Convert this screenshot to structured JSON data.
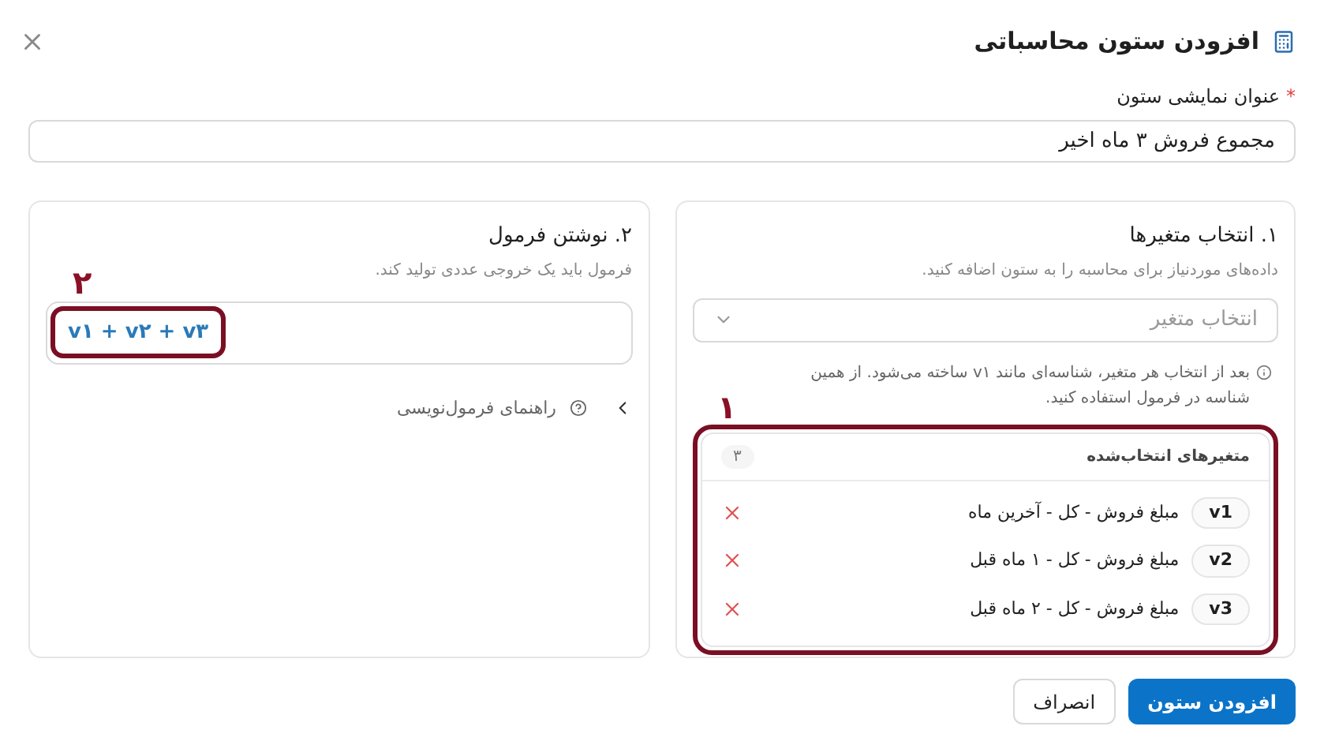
{
  "dialog": {
    "title": "افزودن ستون محاسباتی"
  },
  "column_title": {
    "label": "عنوان نمایشی ستون",
    "required_mark": "*",
    "value": "مجموع فروش ۳ ماه اخیر"
  },
  "variables_panel": {
    "heading": "۱. انتخاب متغیرها",
    "description": "داده‌های موردنیاز برای محاسبه را به ستون اضافه کنید.",
    "select": {
      "placeholder": "انتخاب متغیر"
    },
    "info": "بعد از انتخاب هر متغیر، شناسه‌ای مانند v۱ ساخته می‌شود. از همین شناسه در فرمول استفاده کنید.",
    "annotation": "۱",
    "selected": {
      "title": "متغیرهای انتخاب‌شده",
      "count": "۳",
      "items": [
        {
          "id": "v1",
          "label": "مبلغ فروش - کل - آخرین ماه"
        },
        {
          "id": "v2",
          "label": "مبلغ فروش - کل - ۱ ماه قبل"
        },
        {
          "id": "v3",
          "label": "مبلغ فروش - کل - ۲ ماه قبل"
        }
      ]
    }
  },
  "formula_panel": {
    "heading": "۲. نوشتن فرمول",
    "description": "فرمول باید یک خروجی عددی تولید کند.",
    "annotation": "۲",
    "value": "v۱ + v۲ + v۳",
    "help": {
      "label": "راهنمای فرمول‌نویسی",
      "expanded": false
    }
  },
  "buttons": [
    {
      "label": "افزودن ستون",
      "kind": "primary"
    },
    {
      "label": "انصراف",
      "kind": "secondary"
    }
  ]
}
